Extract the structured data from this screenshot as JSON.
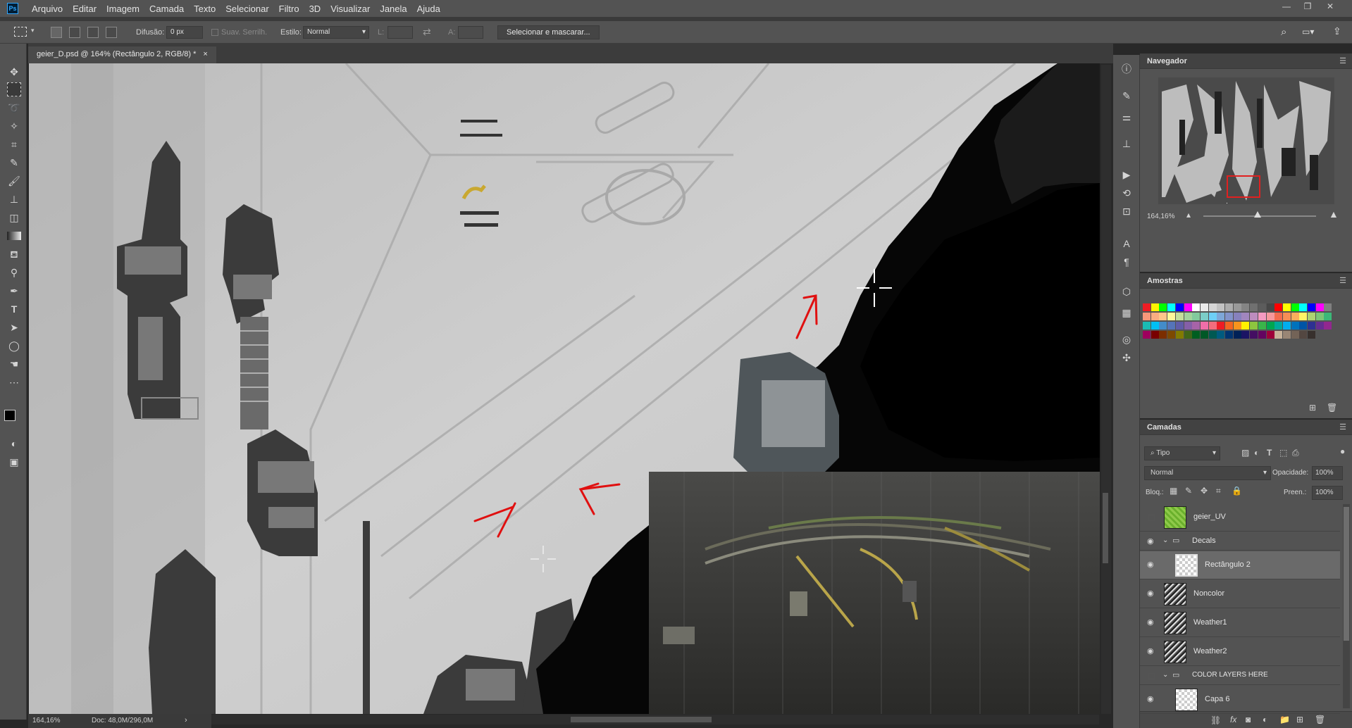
{
  "menu": {
    "app_logo": "Ps",
    "items": [
      "Arquivo",
      "Editar",
      "Imagem",
      "Camada",
      "Texto",
      "Selecionar",
      "Filtro",
      "3D",
      "Visualizar",
      "Janela",
      "Ajuda"
    ]
  },
  "window_controls": {
    "minimize": "—",
    "restore": "❐",
    "close": "✕"
  },
  "options": {
    "feather_label": "Difusão:",
    "feather_value": "0 px",
    "antialias_label": "Suav. Serrilh.",
    "style_label": "Estilo:",
    "style_value": "Normal",
    "width_label": "L:",
    "height_label": "A:",
    "select_mask_button": "Selecionar e mascarar..."
  },
  "document": {
    "tab_title": "geier_D.psd @ 164% (Rectângulo 2, RGB/8) *",
    "tab_close": "×",
    "zoom": "164,16%",
    "doc_info": "Doc: 48,0M/296,0M"
  },
  "navigator": {
    "title": "Navegador",
    "zoom": "164,16%",
    "zoom_slider_level": 0.48
  },
  "swatches": {
    "title": "Amostras",
    "rows": [
      [
        "#ed1c24",
        "#fff200",
        "#00ff00",
        "#00ffff",
        "#0000ff",
        "#ff00ff",
        "#ffffff",
        "#ebebeb",
        "#d6d6d6",
        "#c2c2c2",
        "#adadad",
        "#999999",
        "#858585",
        "#707070",
        "#5c5c5c",
        "#474747",
        "#ff0000",
        "#ffff00",
        "#00ff00",
        "#00ffff",
        "#0000ff",
        "#ff00ff",
        "#808080"
      ],
      [
        "#f7977a",
        "#f9ad81",
        "#fdc68a",
        "#fff79a",
        "#c4df9b",
        "#a3d39c",
        "#82ca9d",
        "#7bcdc8",
        "#6ecff6",
        "#7ea7d8",
        "#8393ca",
        "#8781bd",
        "#a186be",
        "#bd8cbf",
        "#f49ac1",
        "#f5989d",
        "#f26c4f",
        "#f68e55",
        "#fbaf5c",
        "#fff467",
        "#acd372",
        "#7cc576",
        "#3bb878"
      ],
      [
        "#1abbb4",
        "#00bff3",
        "#438cca",
        "#5574b9",
        "#605ca8",
        "#855fa8",
        "#a763a8",
        "#f06ea9",
        "#f26d7d",
        "#ed1c24",
        "#f26522",
        "#f7941d",
        "#fff200",
        "#8dc63f",
        "#39b54a",
        "#00a651",
        "#00a99d",
        "#00aeef",
        "#0072bc",
        "#0054a6",
        "#2e3192",
        "#662d91",
        "#92278f"
      ],
      [
        "#9e005d",
        "#790000",
        "#7b2e00",
        "#7d4900",
        "#827b00",
        "#406618",
        "#005e20",
        "#005826",
        "#005952",
        "#005b7f",
        "#003471",
        "#002157",
        "#1b1464",
        "#440e62",
        "#630460",
        "#9e0039",
        "#c7b299",
        "#998675",
        "#736357",
        "#534741",
        "#37302d"
      ]
    ]
  },
  "layers": {
    "title": "Camadas",
    "filter_kind": "Tipo",
    "blend_mode": "Normal",
    "opacity_label": "Opacidade:",
    "opacity_value": "100%",
    "lock_label": "Bloq.:",
    "fill_label": "Preen.:",
    "fill_value": "100%",
    "items": [
      {
        "name": "geier_UV",
        "visible": false
      },
      {
        "name": "Decals",
        "visible": true,
        "group": true
      },
      {
        "name": "Rectângulo 2",
        "visible": true,
        "selected": true
      },
      {
        "name": "Noncolor",
        "visible": true
      },
      {
        "name": "Weather1",
        "visible": true
      },
      {
        "name": "Weather2",
        "visible": true
      },
      {
        "name": "COLOR LAYERS HERE",
        "visible": false,
        "group": true
      },
      {
        "name": "Capa 6",
        "visible": true
      }
    ]
  }
}
